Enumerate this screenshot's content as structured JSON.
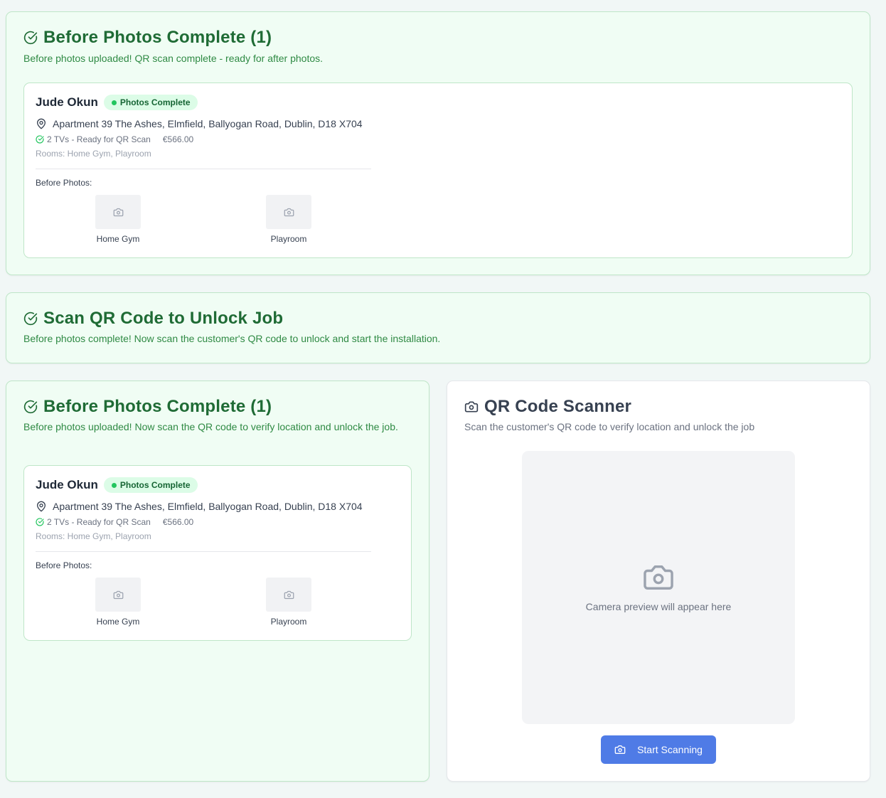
{
  "section1": {
    "title": "Before Photos Complete (1)",
    "subtitle": "Before photos uploaded! QR scan complete - ready for after photos.",
    "job": {
      "name": "Jude Okun",
      "badge": "Photos Complete",
      "address": "Apartment 39 The Ashes, Elmfield, Ballyogan Road, Dublin, D18 X704",
      "tvs": "2 TVs - Ready for QR Scan",
      "price": "€566.00",
      "rooms": "Rooms: Home Gym, Playroom",
      "before_photos_label": "Before Photos:",
      "photos": [
        "Home Gym",
        "Playroom"
      ]
    }
  },
  "section2": {
    "title": "Scan QR Code to Unlock Job",
    "subtitle": "Before photos complete! Now scan the customer's QR code to unlock and start the installation."
  },
  "section3": {
    "title": "Before Photos Complete (1)",
    "subtitle": "Before photos uploaded! Now scan the QR code to verify location and unlock the job.",
    "job": {
      "name": "Jude Okun",
      "badge": "Photos Complete",
      "address": "Apartment 39 The Ashes, Elmfield, Ballyogan Road, Dublin, D18 X704",
      "tvs": "2 TVs - Ready for QR Scan",
      "price": "€566.00",
      "rooms": "Rooms: Home Gym, Playroom",
      "before_photos_label": "Before Photos:",
      "photos": [
        "Home Gym",
        "Playroom"
      ]
    }
  },
  "scanner": {
    "title": "QR Code Scanner",
    "subtitle": "Scan the customer's QR code to verify location and unlock the job",
    "preview_text": "Camera preview will appear here",
    "button_label": "Start Scanning"
  },
  "icons": {
    "check": "check-circle-icon",
    "map_pin": "map-pin-icon",
    "camera": "camera-icon"
  },
  "colors": {
    "accent_green": "#1f6b35",
    "badge_bg": "#dcfce7",
    "primary_button": "#4f7be6"
  }
}
